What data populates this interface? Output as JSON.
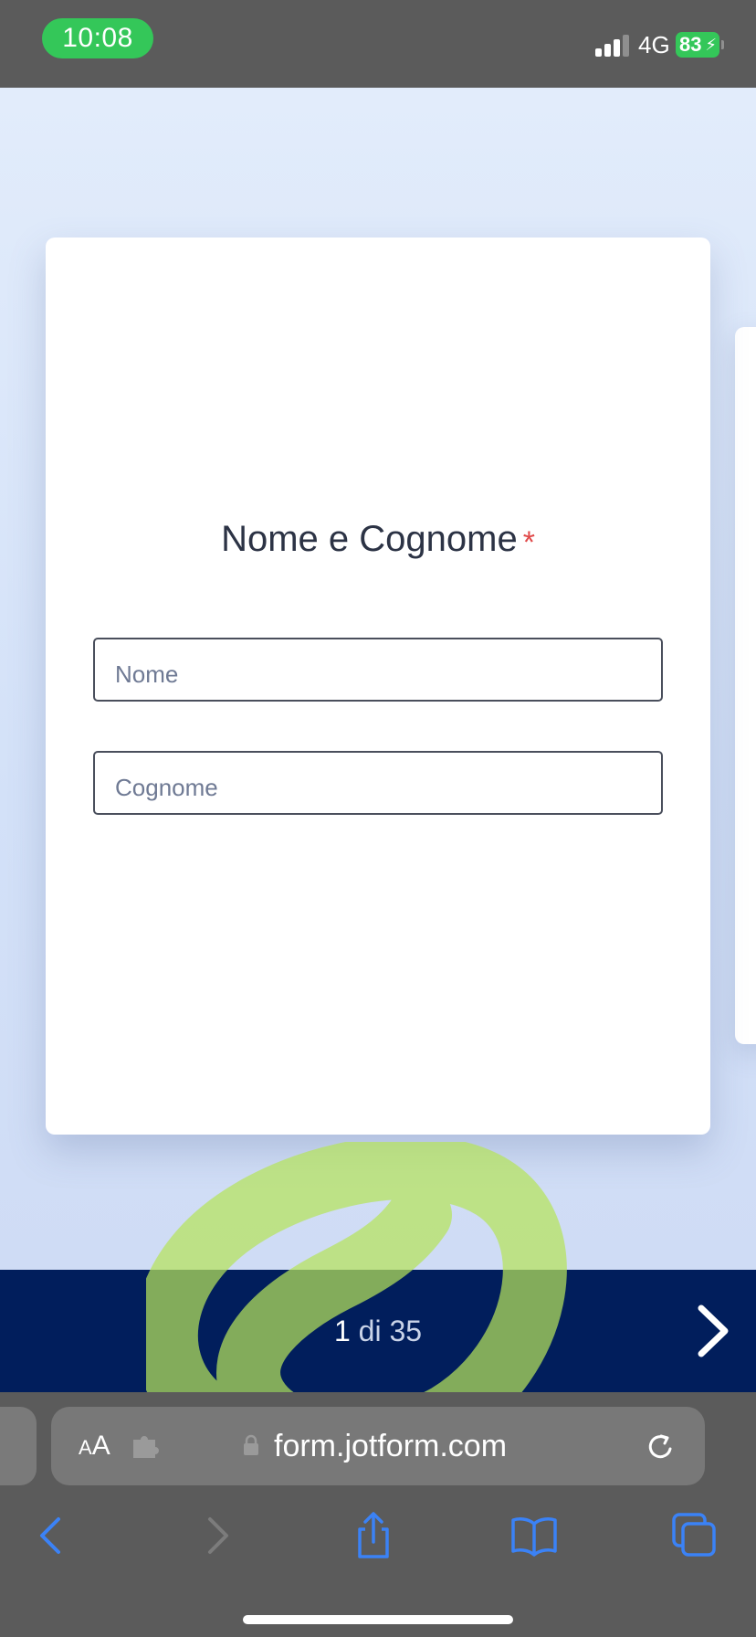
{
  "status_bar": {
    "time": "10:08",
    "network": "4G",
    "battery": "83"
  },
  "form": {
    "question_label": "Nome e Cognome",
    "required_marker": "*",
    "first_name_placeholder": "Nome",
    "last_name_placeholder": "Cognome"
  },
  "navigation": {
    "current_page": "1",
    "separator": "di",
    "total_pages": "35"
  },
  "browser": {
    "reader_button_small": "A",
    "reader_button_large": "A",
    "url": "form.jotform.com"
  },
  "colors": {
    "accent_green": "#34c759",
    "nav_bar": "#011e5c",
    "browser_blue": "#3b82f6",
    "required": "#e04a4a"
  },
  "icons": {
    "next": "chevron-right-icon",
    "lock": "lock-icon",
    "reload": "reload-icon",
    "back": "back-icon",
    "forward": "forward-icon",
    "share": "share-icon",
    "bookmarks": "book-icon",
    "tabs": "tabs-icon",
    "extension": "puzzle-icon"
  }
}
